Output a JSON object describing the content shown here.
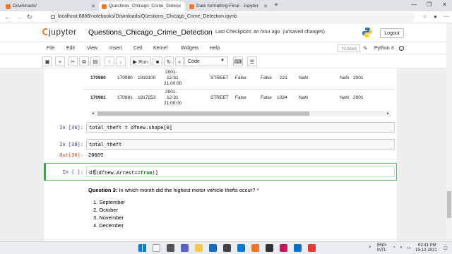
{
  "browser": {
    "tabs": [
      {
        "label": "Downloads/",
        "active": false
      },
      {
        "label": "Questions_Chicago_Crime_Detec",
        "active": true
      },
      {
        "label": "Date formatting-Final - Jupyter",
        "active": false
      }
    ],
    "url": "localhost:8888/notebooks/Downloads/Questions_Chicago_Crime_Detection.ipynb"
  },
  "header": {
    "logo_text": "jupyter",
    "notebook_title": "Questions_Chicago_Crime_Detection",
    "checkpoint": "Last Checkpoint: an hour ago",
    "status": "(unsaved changes)",
    "logout_label": "Logout"
  },
  "menubar": {
    "items": [
      "File",
      "Edit",
      "View",
      "Insert",
      "Cell",
      "Kernel",
      "Widgets",
      "Help"
    ],
    "trusted": "Trusted",
    "kernel": "Python 3"
  },
  "toolbar": {
    "run_label": "Run",
    "cell_type": "Code"
  },
  "dataframe_rows": [
    {
      "index": "170980",
      "c1": "170980",
      "c2": "1919100",
      "date": [
        "2001-",
        "12-31",
        "21:00:00"
      ],
      "loc": "STREET",
      "arrest": "False",
      "domestic": "False",
      "beat": "221",
      "n1": "NaN",
      "n2": "NaN",
      "year": "2001"
    },
    {
      "index": "170981",
      "c1": "170981",
      "c2": "1917253",
      "date": [
        "2001-",
        "12-31",
        "21:00:00"
      ],
      "loc": "STREET",
      "arrest": "False",
      "domestic": "False",
      "beat": "1034",
      "n1": "NaN",
      "n2": "NaN",
      "year": "2001"
    }
  ],
  "cells": {
    "c36_prompt": "In [36]:",
    "c36_code": "total_theft = dfnew.shape[0]",
    "c38_prompt": "In [38]:",
    "c38_code": "total_theft",
    "out38_prompt": "Out[38]:",
    "out38_value": "20669",
    "active_prompt": "In [ ]:",
    "active_code_a": "df",
    "active_code_b": "(dfnew.Arrest==",
    "active_code_kw": "True",
    "active_code_c": ")]"
  },
  "question": {
    "label": "Question 3:",
    "text": "In which month did the highest motor vehicle thefts occur? *",
    "options": [
      "September",
      "October",
      "November",
      "December"
    ]
  },
  "taskbar": {
    "lang": "ENG",
    "region": "INTL",
    "time": "02:41 PM",
    "date": "19-12-2021"
  }
}
